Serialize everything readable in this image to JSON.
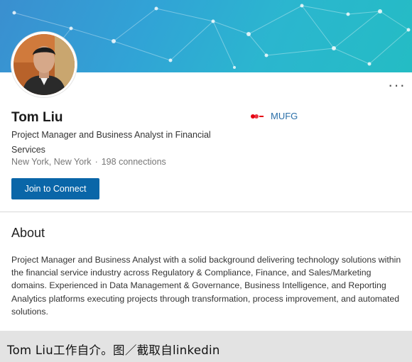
{
  "profile": {
    "name": "Tom Liu",
    "headline": "Project Manager and Business Analyst in Financial Services",
    "location": "New York, New York",
    "separator": "·",
    "connections": "198 connections",
    "company": "MUFG",
    "more_label": "···"
  },
  "actions": {
    "join_label": "Join to Connect"
  },
  "about": {
    "title": "About",
    "body": "Project Manager and Business Analyst with a solid background delivering technology solutions within the financial service industry across Regulatory & Compliance, Finance, and Sales/Marketing domains. Experienced in Data Management & Governance, Business Intelligence, and Reporting Analytics platforms executing projects through transformation, process improvement, and automated solutions."
  },
  "caption": {
    "text": "Tom Liu工作自介。图／截取自linkedin"
  },
  "colors": {
    "button": "#0a66a8",
    "company_link": "#2a6fa8",
    "banner": "#2bb6cf",
    "logo": "#e60012"
  },
  "icons": {
    "more": "more-horizontal-icon",
    "company_logo": "mufg-logo-icon"
  }
}
